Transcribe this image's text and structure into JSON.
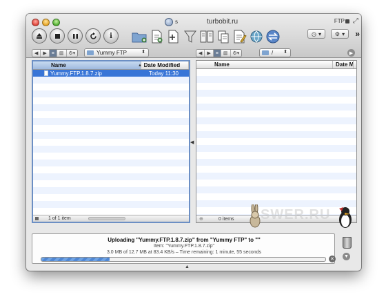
{
  "window": {
    "title_prefix": "s",
    "title": "turbobit.ru",
    "ftp_label": "FTP"
  },
  "toolbar": {
    "left_buttons": [
      "eject-icon",
      "stop-icon",
      "pause-icon",
      "refresh-icon",
      "info-icon"
    ],
    "info_label": "i"
  },
  "left_pane": {
    "path": "Yummy FTP",
    "columns": {
      "name": "Name",
      "date": "Date Modified"
    },
    "files": [
      {
        "name": "Yummy.FTP.1.8.7.zip",
        "date": "Today 11:30"
      }
    ],
    "footer": "1 of 1 item"
  },
  "right_pane": {
    "path": "/",
    "columns": {
      "name": "Name",
      "date": "Date M"
    },
    "footer": "0 items"
  },
  "transfer": {
    "title": "Uploading \"Yummy.FTP.1.8.7.zip\" from \"Yummy FTP\" to \"\"",
    "item": "Item: \"Yummy.FTP.1.8.7.zip\"",
    "stats": "3.0 MB of 12.7 MB at 83.4 KB/s  –  Time remaining: 1 minute, 55 seconds",
    "progress_percent": 24
  },
  "watermark": "SWER.RU",
  "colors": {
    "selection": "#3875d7",
    "pane_focus": "#6c8fc4",
    "stripe": "#edf3fe"
  }
}
